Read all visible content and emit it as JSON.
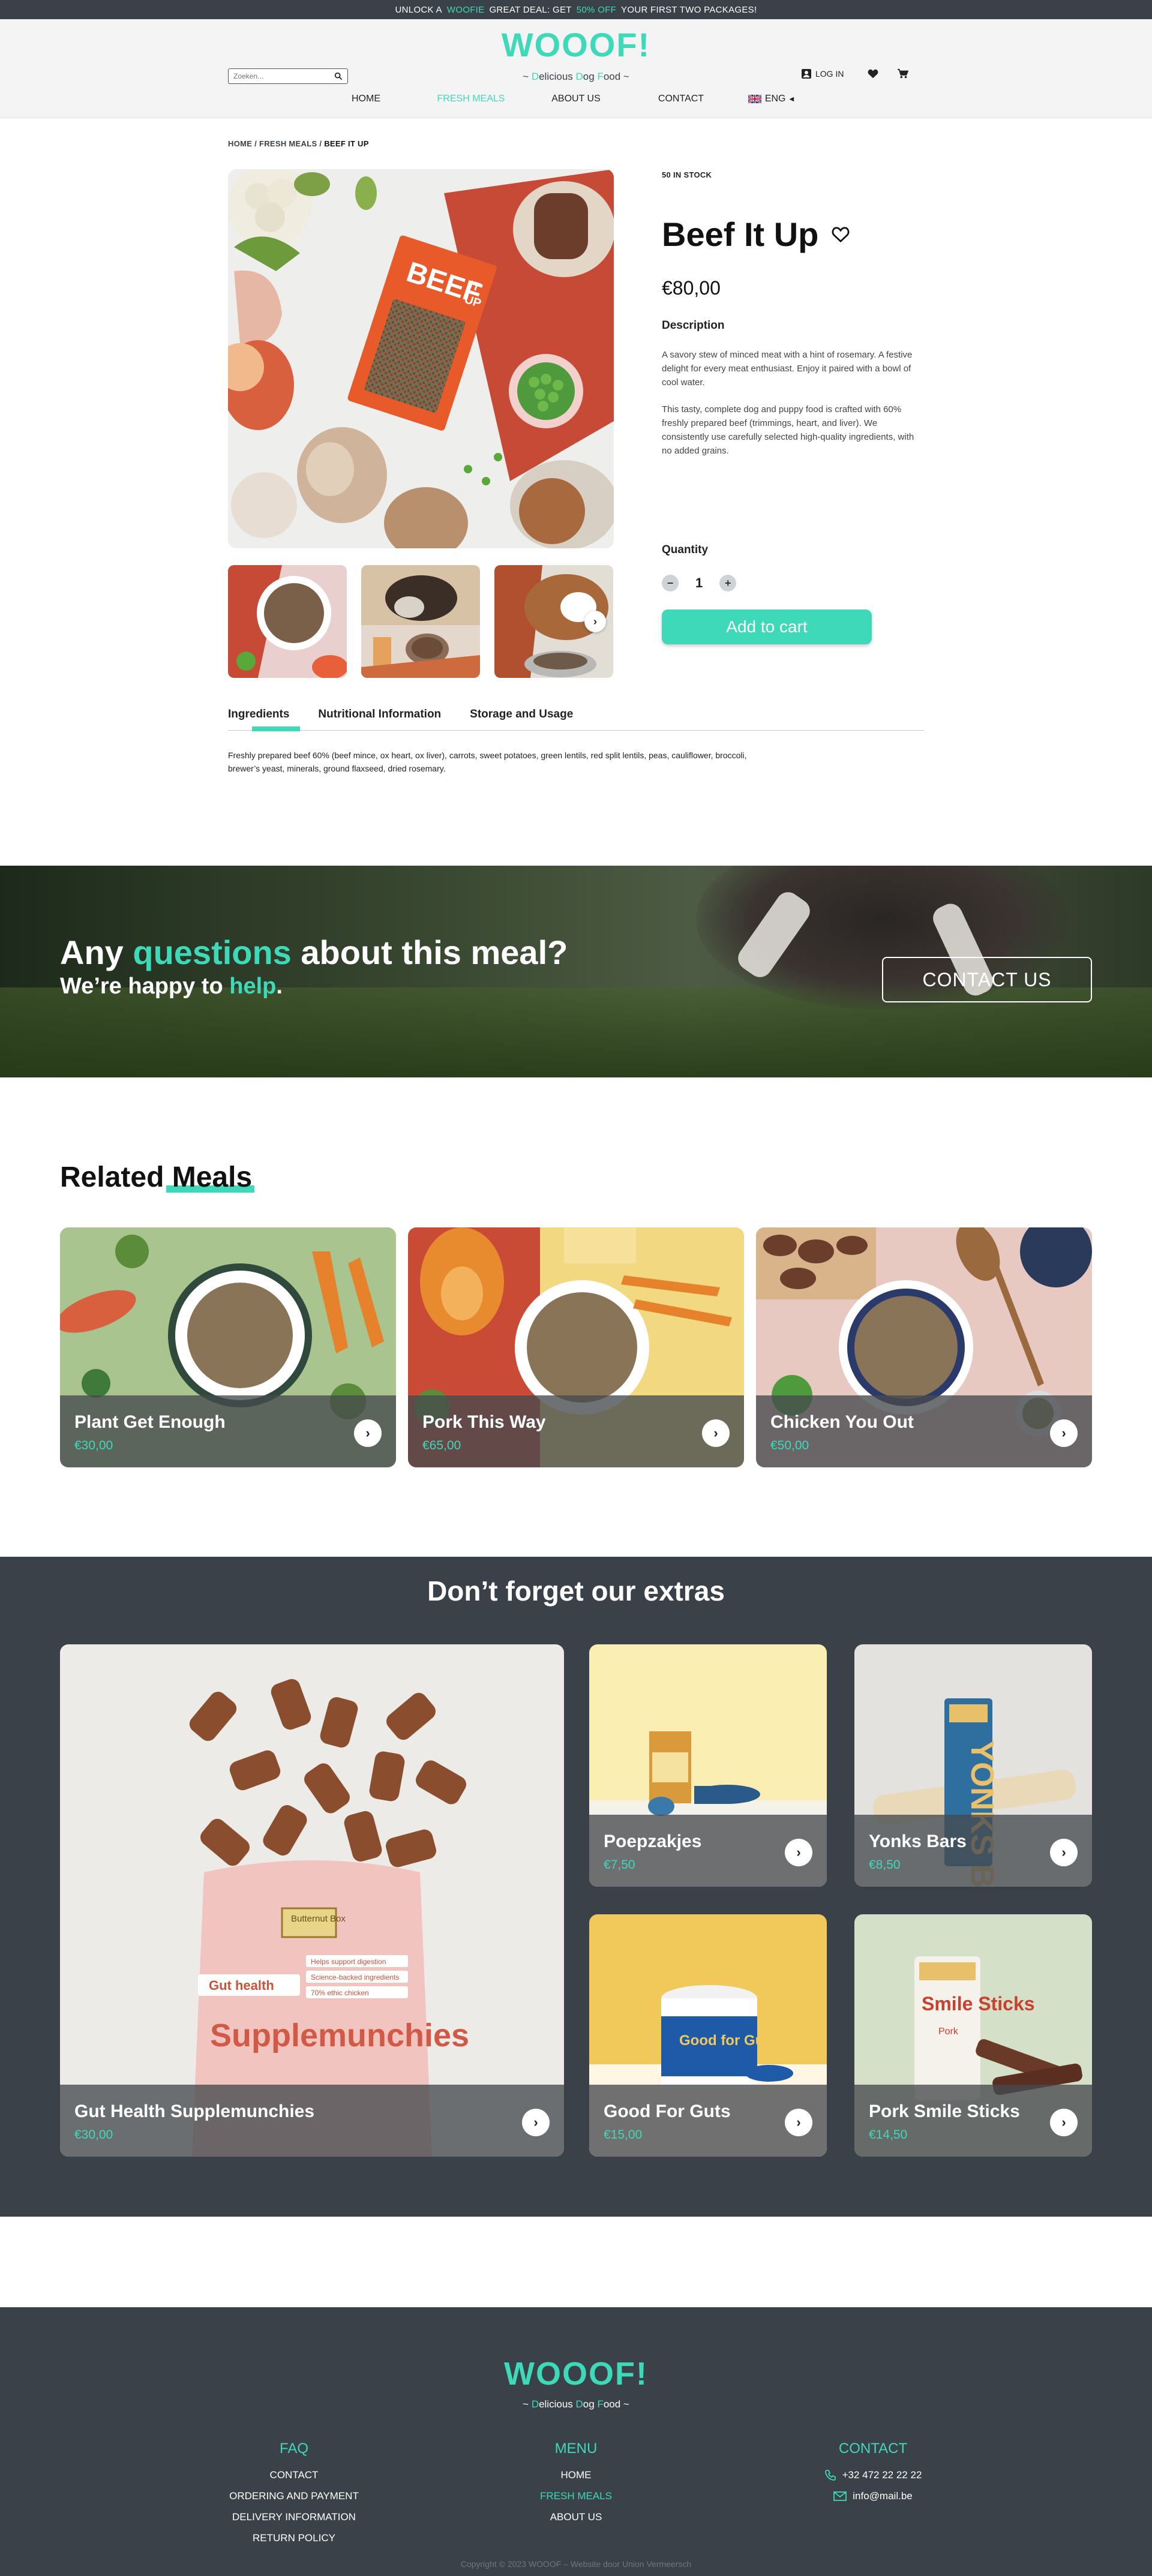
{
  "announcement": {
    "pre": "UNLOCK A",
    "brand": "WOOFIE",
    "mid": "GREAT DEAL: GET",
    "deal": "50% OFF",
    "post": "YOUR FIRST TWO PACKAGES!"
  },
  "header": {
    "logo": "WOOOF!",
    "tagline_parts": [
      "~ ",
      "D",
      "elicious ",
      "D",
      "og ",
      "F",
      "ood ~"
    ],
    "search_placeholder": "Zoeken...",
    "login_label": "LOG IN"
  },
  "nav": {
    "items": [
      "HOME",
      "FRESH MEALS",
      "ABOUT US",
      "CONTACT",
      "ENG"
    ],
    "active": "FRESH MEALS"
  },
  "breadcrumb": {
    "home": "HOME",
    "sep": " / ",
    "category": "FRESH MEALS",
    "current": "BEEF IT UP"
  },
  "product": {
    "stock": "50 IN STOCK",
    "title": "Beef It Up",
    "price": "€80,00",
    "description_heading": "Description",
    "description": [
      "A savory stew of minced meat with a hint of rosemary. A festive delight for every meat enthusiast. Enjoy it paired with a bowl of cool water.",
      "This tasty, complete dog and puppy food is crafted with 60% freshly prepared beef (trimmings, heart, and liver). We consistently use carefully selected high-quality ingredients, with no added grains."
    ],
    "quantity_label": "Quantity",
    "quantity": "1",
    "add_to_cart": "Add to cart",
    "package_text": "BEEF IT UP"
  },
  "tabs": {
    "items": [
      "Ingredients",
      "Nutritional Information",
      "Storage and Usage"
    ],
    "active": "Ingredients",
    "content": "Freshly prepared beef 60% (beef mince, ox heart, ox liver), carrots, sweet potatoes, green lentils, red split lentils, peas, cauliflower, broccoli, brewer’s yeast, minerals, ground flaxseed, dried rosemary."
  },
  "question_banner": {
    "line1_pre": "Any",
    "line1_hl": "questions",
    "line1_post": "about this meal?",
    "line2_pre": "We’re happy to",
    "line2_hl": "help",
    "line2_post": ".",
    "button": "CONTACT US"
  },
  "related": {
    "title_pre": "Related",
    "title_hl": "Meals",
    "items": [
      {
        "name": "Plant Get Enough",
        "price": "€30,00",
        "color": "#a9c48e"
      },
      {
        "name": "Pork This Way",
        "price": "€65,00",
        "color": "#c94a35"
      },
      {
        "name": "Chicken You Out",
        "price": "€50,00",
        "color": "#e8c9c2"
      }
    ]
  },
  "extras": {
    "title_pre": "Don’t forget",
    "title_hl": "our extras",
    "items": [
      {
        "name": "Gut Health Supplemunchies",
        "price": "€30,00",
        "pack_title": "Supplemunchies",
        "pack_label": "Gut health",
        "brand": "Butternut Box",
        "bullets": [
          "Helps support digestion",
          "Science-backed ingredients",
          "70% ethic chicken"
        ]
      },
      {
        "name": "Poepzakjes",
        "price": "€7,50"
      },
      {
        "name": "Yonks Bars",
        "price": "€8,50",
        "pack_title": "YONKS BAR"
      },
      {
        "name": "Good For Guts",
        "price": "€15,00",
        "pack_title": "Good for Guts"
      },
      {
        "name": "Pork Smile Sticks",
        "price": "€14,50",
        "pack_title": "Smile Sticks",
        "pack_label": "Pork"
      }
    ]
  },
  "footer": {
    "logo": "WOOOF!",
    "tagline_parts": [
      "~ ",
      "D",
      "elicious ",
      "D",
      "og ",
      "F",
      "ood ~"
    ],
    "faq": {
      "title": "FAQ",
      "links": [
        "CONTACT",
        "ORDERING AND PAYMENT",
        "DELIVERY INFORMATION",
        "RETURN POLICY"
      ]
    },
    "menu": {
      "title": "MENU",
      "links": [
        "HOME",
        "FRESH MEALS",
        "ABOUT US"
      ],
      "active": "FRESH MEALS"
    },
    "contact": {
      "title": "CONTACT",
      "phone": "+32 472 22 22 22",
      "email": "info@mail.be"
    },
    "copyright": "Copyright © 2023 WOOOF – Website door Union Vermeersch"
  },
  "colors": {
    "accent": "#3dd9b8",
    "dark": "#3a4149"
  }
}
